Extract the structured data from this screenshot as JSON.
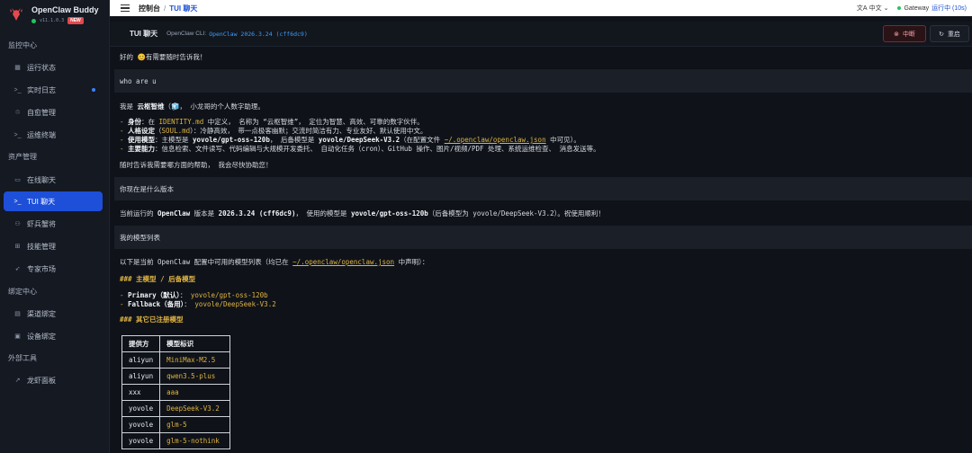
{
  "app": {
    "name": "OpenClaw Buddy",
    "version": "v11.1.0.3",
    "badge": "NEW"
  },
  "sidebar": {
    "sections": [
      {
        "title": "监控中心",
        "items": [
          {
            "label": "运行状态",
            "icon": "bar-chart-icon"
          },
          {
            "label": "实时日志",
            "icon": "terminal-icon",
            "dot": true
          },
          {
            "label": "自愈管理",
            "icon": "heal-icon"
          },
          {
            "label": "运维终端",
            "icon": "terminal-icon"
          }
        ]
      },
      {
        "title": "资产管理",
        "items": [
          {
            "label": "在线聊天",
            "icon": "chat-icon"
          },
          {
            "label": "TUI 聊天",
            "icon": "terminal-icon",
            "active": true
          },
          {
            "label": "虾兵蟹将",
            "icon": "team-icon"
          },
          {
            "label": "技能管理",
            "icon": "skill-icon"
          },
          {
            "label": "专家市场",
            "icon": "rocket-icon"
          }
        ]
      },
      {
        "title": "绑定中心",
        "items": [
          {
            "label": "渠道绑定",
            "icon": "channel-icon"
          },
          {
            "label": "设备绑定",
            "icon": "device-icon"
          }
        ]
      },
      {
        "title": "外部工具",
        "items": [
          {
            "label": "龙虾面板",
            "icon": "external-link-icon"
          }
        ]
      }
    ]
  },
  "topbar": {
    "breadcrumb_root": "控制台",
    "breadcrumb_sep": "/",
    "breadcrumb_current": "TUI 聊天",
    "language": "中文",
    "gateway_label": "Gateway",
    "gateway_status": "运行中 (10s)"
  },
  "panel": {
    "title": "TUI 聊天",
    "cli_label": "OpenClaw CLI:",
    "cli_version": "OpenClaw 2026.3.24 (cff6dc9)",
    "stop_label": "中断",
    "restart_label": "重启"
  },
  "chat": {
    "line1": "好的 😊有需要随时告诉我！",
    "user1": "who are u",
    "intro_pre": "我是 ",
    "intro_name": "云枢智维",
    "intro_mid": "（🧊，",
    "intro_post": " 小龙哥的个人数字助理。",
    "b1_label": "身份",
    "b1_text_a": "：在 ",
    "b1_code": "IDENTITY.md",
    "b1_text_b": " 中定义， 名称为 “云枢智维”， 定位为智慧、高效、可靠的数字伙伴。",
    "b2_label": "人格设定",
    "b2_text_a": "（",
    "b2_code": "SOUL.md",
    "b2_text_b": "）：冷静高效， 带一点极客幽默；交流时简洁有力、专业友好、默认使用中文。",
    "b3_label": "使用模型",
    "b3_text_a": "：主模型是 ",
    "b3_m1": "yovole/gpt-oss-120b",
    "b3_text_b": "， 后备模型是 ",
    "b3_m2": "yovole/DeepSeek-V3.2",
    "b3_text_c": "（在配置文件 ",
    "b3_link": "~/.openclaw/openclaw.json",
    "b3_text_d": " 中可见）。",
    "b4_label": "主要能力",
    "b4_text": "：信息检索、文件读写、代码编辑与大规模开发委托、 自动化任务（cron）、GitHub 操作、图片/视频/PDF 处理、系统运维检查、 消息发送等。",
    "closing": "随时告诉我需要哪方面的帮助， 我会尽快协助您！",
    "user2": "你现在是什么版本",
    "ver_a": "当前运行的 ",
    "ver_b": "OpenClaw",
    "ver_c": " 版本是 ",
    "ver_d": "2026.3.24 (cff6dc9)",
    "ver_e": "， 使用的模型是 ",
    "ver_f": "yovole/gpt-oss-120b",
    "ver_g": "（后备模型为 yovole/DeepSeek-V3.2）。祝使用顺利！",
    "user3": "我的模型列表",
    "list_a": "以下是当前 OpenClaw 配置中可用的模型列表（均已在 ",
    "list_link": "~/.openclaw/openclaw.json",
    "list_b": " 中声明）：",
    "h_main": "### 主模型 / 后备模型",
    "primary_label": "Primary（默认）",
    "primary_sep": "：",
    "primary_value": "yovole/gpt-oss-120b",
    "fallback_label": "Fallback（备用）",
    "fallback_sep": "：",
    "fallback_value": "yovole/DeepSeek-V3.2",
    "h_other": "### 其它已注册模型",
    "table_headers": [
      "提供方",
      "模型标识"
    ],
    "table_rows": [
      [
        "aliyun",
        "MiniMax-M2.5"
      ],
      [
        "aliyun",
        "qwen3.5-plus"
      ],
      [
        "xxx",
        "aaa"
      ],
      [
        "yovole",
        "DeepSeek-V3.2"
      ],
      [
        "yovole",
        "glm-5"
      ],
      [
        "yovole",
        "glm-5-nothink"
      ]
    ]
  }
}
